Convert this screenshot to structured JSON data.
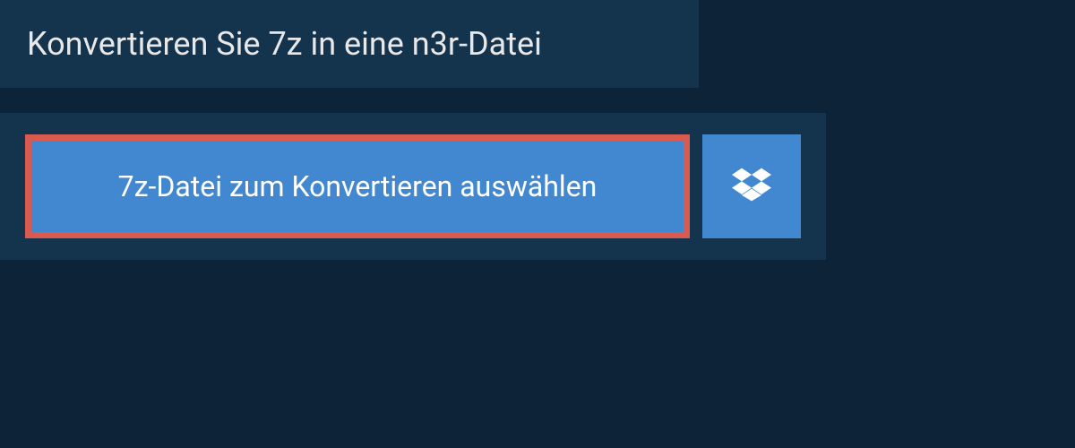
{
  "header": {
    "title": "Konvertieren Sie 7z in eine n3r-Datei"
  },
  "upload": {
    "select_label": "7z-Datei zum Konvertieren auswählen",
    "dropbox_icon": "dropbox"
  }
}
